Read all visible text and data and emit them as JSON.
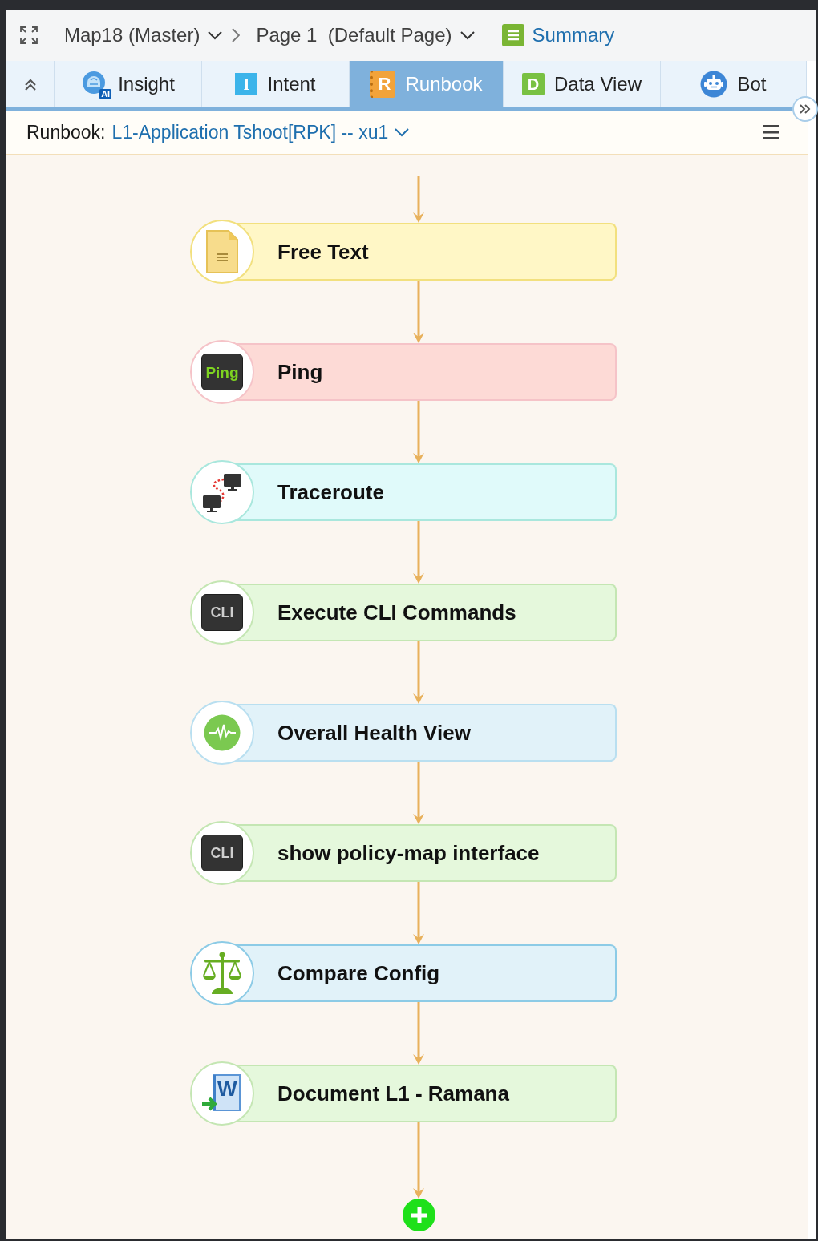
{
  "breadcrumbs": [
    {
      "label": "Map18 (Master)"
    },
    {
      "label": "Page 1  (Default Page)"
    }
  ],
  "summary_link": {
    "label": "Summary"
  },
  "tabs": [
    {
      "kind": "insight",
      "label": "Insight",
      "icon_text": "AI",
      "selected": false
    },
    {
      "kind": "intent",
      "label": "Intent",
      "icon_text": "I",
      "selected": false
    },
    {
      "kind": "runbook",
      "label": "Runbook",
      "icon_text": "R",
      "selected": true
    },
    {
      "kind": "data-view",
      "label": "Data View",
      "icon_text": "D",
      "selected": false
    },
    {
      "kind": "bot",
      "label": "Bot",
      "selected": false
    }
  ],
  "runbook_bar": {
    "label": "Runbook:",
    "runbook_name": "L1-Application Tshoot[RPK] -- xu1"
  },
  "steps": [
    {
      "kind": "free-text",
      "label": "Free Text",
      "color": "#fff7c6"
    },
    {
      "kind": "ping",
      "label": "Ping",
      "icon_text": "Ping",
      "color": "#fddad6"
    },
    {
      "kind": "traceroute",
      "label": "Traceroute",
      "color": "#e0fafa"
    },
    {
      "kind": "cli",
      "label": "Execute CLI Commands",
      "icon_text": "CLI",
      "color": "#e5f8dc"
    },
    {
      "kind": "health",
      "label": "Overall Health View",
      "color": "#e1f2f9"
    },
    {
      "kind": "cli",
      "label": "show policy-map interface",
      "icon_text": "CLI",
      "color": "#e5f8dc"
    },
    {
      "kind": "compare",
      "label": "Compare Config",
      "color": "#e1f2f9"
    },
    {
      "kind": "document",
      "label": "Document L1 - Ramana",
      "icon_text": "W",
      "color": "#e5f8dc"
    }
  ]
}
